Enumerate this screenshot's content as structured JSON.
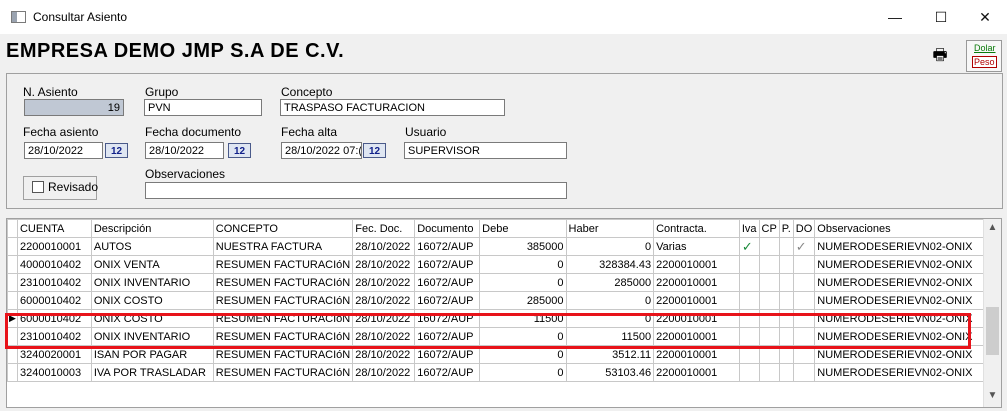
{
  "window": {
    "title": "Consultar Asiento",
    "minimize": "—",
    "maximize": "☐",
    "close": "✕"
  },
  "header": {
    "company": "EMPRESA DEMO JMP S.A DE C.V.",
    "currency_dolar": "Dolar",
    "currency_peso": "Peso"
  },
  "form": {
    "n_asiento": {
      "label": "N. Asiento",
      "value": "19"
    },
    "grupo": {
      "label": "Grupo",
      "value": "PVN"
    },
    "concepto": {
      "label": "Concepto",
      "value": "TRASPASO FACTURACION"
    },
    "fecha_asiento": {
      "label": "Fecha asiento",
      "value": "28/10/2022"
    },
    "fecha_documento": {
      "label": "Fecha documento",
      "value": "28/10/2022"
    },
    "fecha_alta": {
      "label": "Fecha alta",
      "value": "28/10/2022 07:("
    },
    "usuario": {
      "label": "Usuario",
      "value": "SUPERVISOR"
    },
    "date_button": "12",
    "revisado": {
      "label": "Revisado"
    },
    "observaciones": {
      "label": "Observaciones",
      "value": ""
    }
  },
  "grid": {
    "columns": [
      "CUENTA",
      "Descripción",
      "CONCEPTO",
      "Fec. Doc.",
      "Documento",
      "Debe",
      "Haber",
      "Contracta.",
      "Iva",
      "CP",
      "P.",
      "DO",
      "Observaciones"
    ],
    "rows": [
      {
        "cuenta": "2200010001",
        "descripcion": "AUTOS",
        "concepto": "NUESTRA FACTURA",
        "fec": "28/10/2022",
        "doc": "16072/AUP",
        "debe": "385000",
        "haber": "0",
        "contracta": "Varias",
        "iva": true,
        "do": true,
        "obs": "NUMERODESERIEVN02-ONIX"
      },
      {
        "cuenta": "4000010402",
        "descripcion": "ONIX VENTA",
        "concepto": "RESUMEN FACTURACIóN",
        "fec": "28/10/2022",
        "doc": "16072/AUP",
        "debe": "0",
        "haber": "328384.43",
        "contracta": "2200010001",
        "obs": "NUMERODESERIEVN02-ONIX"
      },
      {
        "cuenta": "2310010402",
        "descripcion": "ONIX INVENTARIO",
        "concepto": "RESUMEN FACTURACIóN",
        "fec": "28/10/2022",
        "doc": "16072/AUP",
        "debe": "0",
        "haber": "285000",
        "contracta": "2200010001",
        "obs": "NUMERODESERIEVN02-ONIX"
      },
      {
        "cuenta": "6000010402",
        "descripcion": "ONIX COSTO",
        "concepto": "RESUMEN FACTURACIóN",
        "fec": "28/10/2022",
        "doc": "16072/AUP",
        "debe": "285000",
        "haber": "0",
        "contracta": "2200010001",
        "obs": "NUMERODESERIEVN02-ONIX"
      },
      {
        "cuenta": "6000010402",
        "descripcion": "ONIX COSTO",
        "concepto": "RESUMEN FACTURACIóN",
        "fec": "28/10/2022",
        "doc": "16072/AUP",
        "debe": "11500",
        "haber": "0",
        "contracta": "2200010001",
        "obs": "NUMERODESERIEVN02-ONIX",
        "current": true
      },
      {
        "cuenta": "2310010402",
        "descripcion": "ONIX INVENTARIO",
        "concepto": "RESUMEN FACTURACIóN",
        "fec": "28/10/2022",
        "doc": "16072/AUP",
        "debe": "0",
        "haber": "11500",
        "contracta": "2200010001",
        "obs": "NUMERODESERIEVN02-ONIX"
      },
      {
        "cuenta": "3240020001",
        "descripcion": "ISAN POR PAGAR",
        "concepto": "RESUMEN FACTURACIóN",
        "fec": "28/10/2022",
        "doc": "16072/AUP",
        "debe": "0",
        "haber": "3512.11",
        "contracta": "2200010001",
        "obs": "NUMERODESERIEVN02-ONIX"
      },
      {
        "cuenta": "3240010003",
        "descripcion": "IVA POR TRASLADAR",
        "concepto": "RESUMEN FACTURACIóN",
        "fec": "28/10/2022",
        "doc": "16072/AUP",
        "debe": "0",
        "haber": "53103.46",
        "contracta": "2200010001",
        "obs": "NUMERODESERIEVN02-ONIX"
      }
    ]
  },
  "icons": {
    "print": "printer-icon",
    "current_row": "▶",
    "check": "✓"
  },
  "colors": {
    "highlight": "#e8131a",
    "check_green": "#1a8a3a"
  }
}
